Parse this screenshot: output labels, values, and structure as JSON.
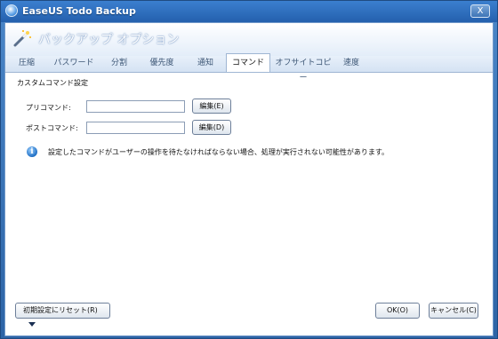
{
  "app": {
    "title": "EaseUS Todo Backup",
    "close_symbol": "X"
  },
  "dialog": {
    "title": "バックアップ オプション"
  },
  "tabs": [
    {
      "label": "圧縮"
    },
    {
      "label": "パスワード"
    },
    {
      "label": "分割"
    },
    {
      "label": "優先度"
    },
    {
      "label": "通知"
    },
    {
      "label": "コマンド",
      "active": true
    },
    {
      "label": "オフサイトコピー"
    },
    {
      "label": "速度"
    }
  ],
  "custom_command": {
    "section_title": "カスタムコマンド設定",
    "pre_label": "プリコマンド:",
    "pre_value": "",
    "pre_edit_button": "編集(E)",
    "post_label": "ポストコマンド:",
    "post_value": "",
    "post_edit_button": "編集(D)",
    "info_text": "設定したコマンドがユーザーの操作を待たなければならない場合、処理が実行されない可能性があります。"
  },
  "footer": {
    "reset_button": "初期設定にリセット(R)",
    "ok_button": "OK(O)",
    "cancel_button": "キャンセル(C)"
  }
}
